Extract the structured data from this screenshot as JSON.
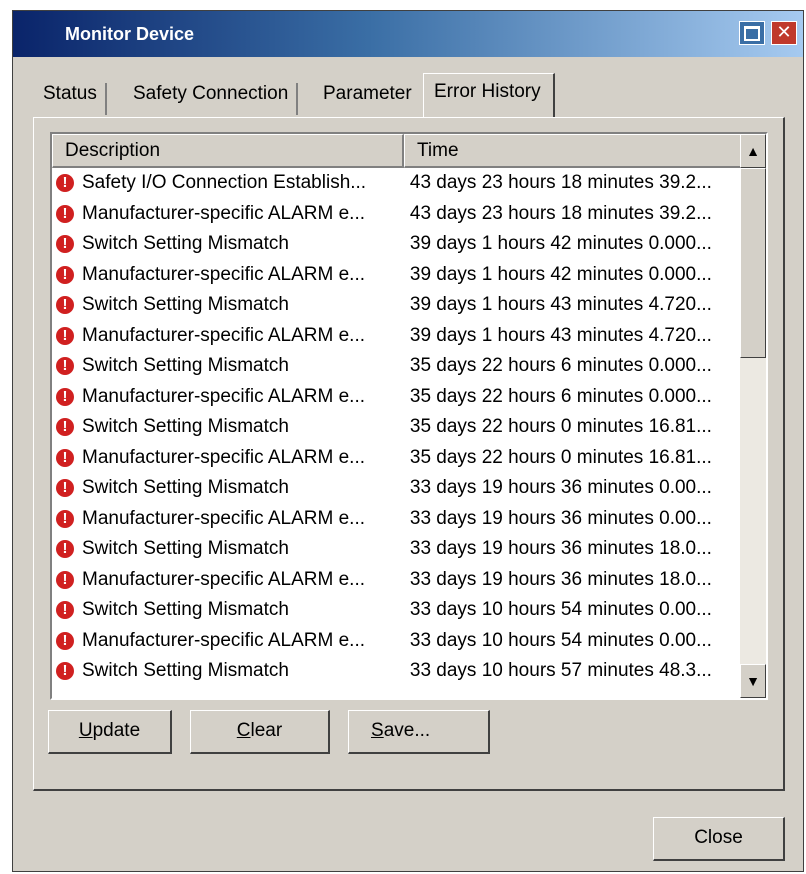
{
  "window": {
    "title": "Monitor Device"
  },
  "tabs": [
    {
      "label": "Status"
    },
    {
      "label": "Safety Connection"
    },
    {
      "label": "Parameter"
    },
    {
      "label": "Error History",
      "active": true
    }
  ],
  "table": {
    "columns": [
      "Description",
      "Time"
    ],
    "rows": [
      {
        "description": "Safety I/O Connection Establish...",
        "time": "43 days 23 hours 18 minutes 39.2..."
      },
      {
        "description": "Manufacturer-specific ALARM e...",
        "time": "43 days 23 hours 18 minutes 39.2..."
      },
      {
        "description": "Switch Setting Mismatch",
        "time": "39 days 1 hours 42 minutes 0.000..."
      },
      {
        "description": "Manufacturer-specific ALARM e...",
        "time": "39 days 1 hours 42 minutes 0.000..."
      },
      {
        "description": "Switch Setting Mismatch",
        "time": "39 days 1 hours 43 minutes 4.720..."
      },
      {
        "description": "Manufacturer-specific ALARM e...",
        "time": "39 days 1 hours 43 minutes 4.720..."
      },
      {
        "description": "Switch Setting Mismatch",
        "time": "35 days 22 hours 6 minutes 0.000..."
      },
      {
        "description": "Manufacturer-specific ALARM e...",
        "time": "35 days 22 hours 6 minutes 0.000..."
      },
      {
        "description": "Switch Setting Mismatch",
        "time": "35 days 22 hours 0 minutes 16.81..."
      },
      {
        "description": "Manufacturer-specific ALARM e...",
        "time": "35 days 22 hours 0 minutes 16.81..."
      },
      {
        "description": "Switch Setting Mismatch",
        "time": "33 days 19 hours 36 minutes 0.00..."
      },
      {
        "description": "Manufacturer-specific ALARM e...",
        "time": "33 days 19 hours 36 minutes 0.00..."
      },
      {
        "description": "Switch Setting Mismatch",
        "time": "33 days 19 hours 36 minutes 18.0..."
      },
      {
        "description": "Manufacturer-specific ALARM e...",
        "time": "33 days 19 hours 36 minutes 18.0..."
      },
      {
        "description": "Switch Setting Mismatch",
        "time": "33 days 10 hours 54 minutes 0.00..."
      },
      {
        "description": "Manufacturer-specific ALARM e...",
        "time": "33 days 10 hours 54 minutes 0.00..."
      },
      {
        "description": "Switch Setting Mismatch",
        "time": "33 days 10 hours 57 minutes 48.3..."
      }
    ]
  },
  "buttons": {
    "update": {
      "mnemonic": "U",
      "rest": "pdate"
    },
    "clear": {
      "mnemonic": "C",
      "rest": "lear"
    },
    "save": {
      "mnemonic": "S",
      "rest": "ave..."
    },
    "close": "Close"
  },
  "icons": {
    "row_icon": "error-icon",
    "row_icon_color": "#d02020"
  }
}
